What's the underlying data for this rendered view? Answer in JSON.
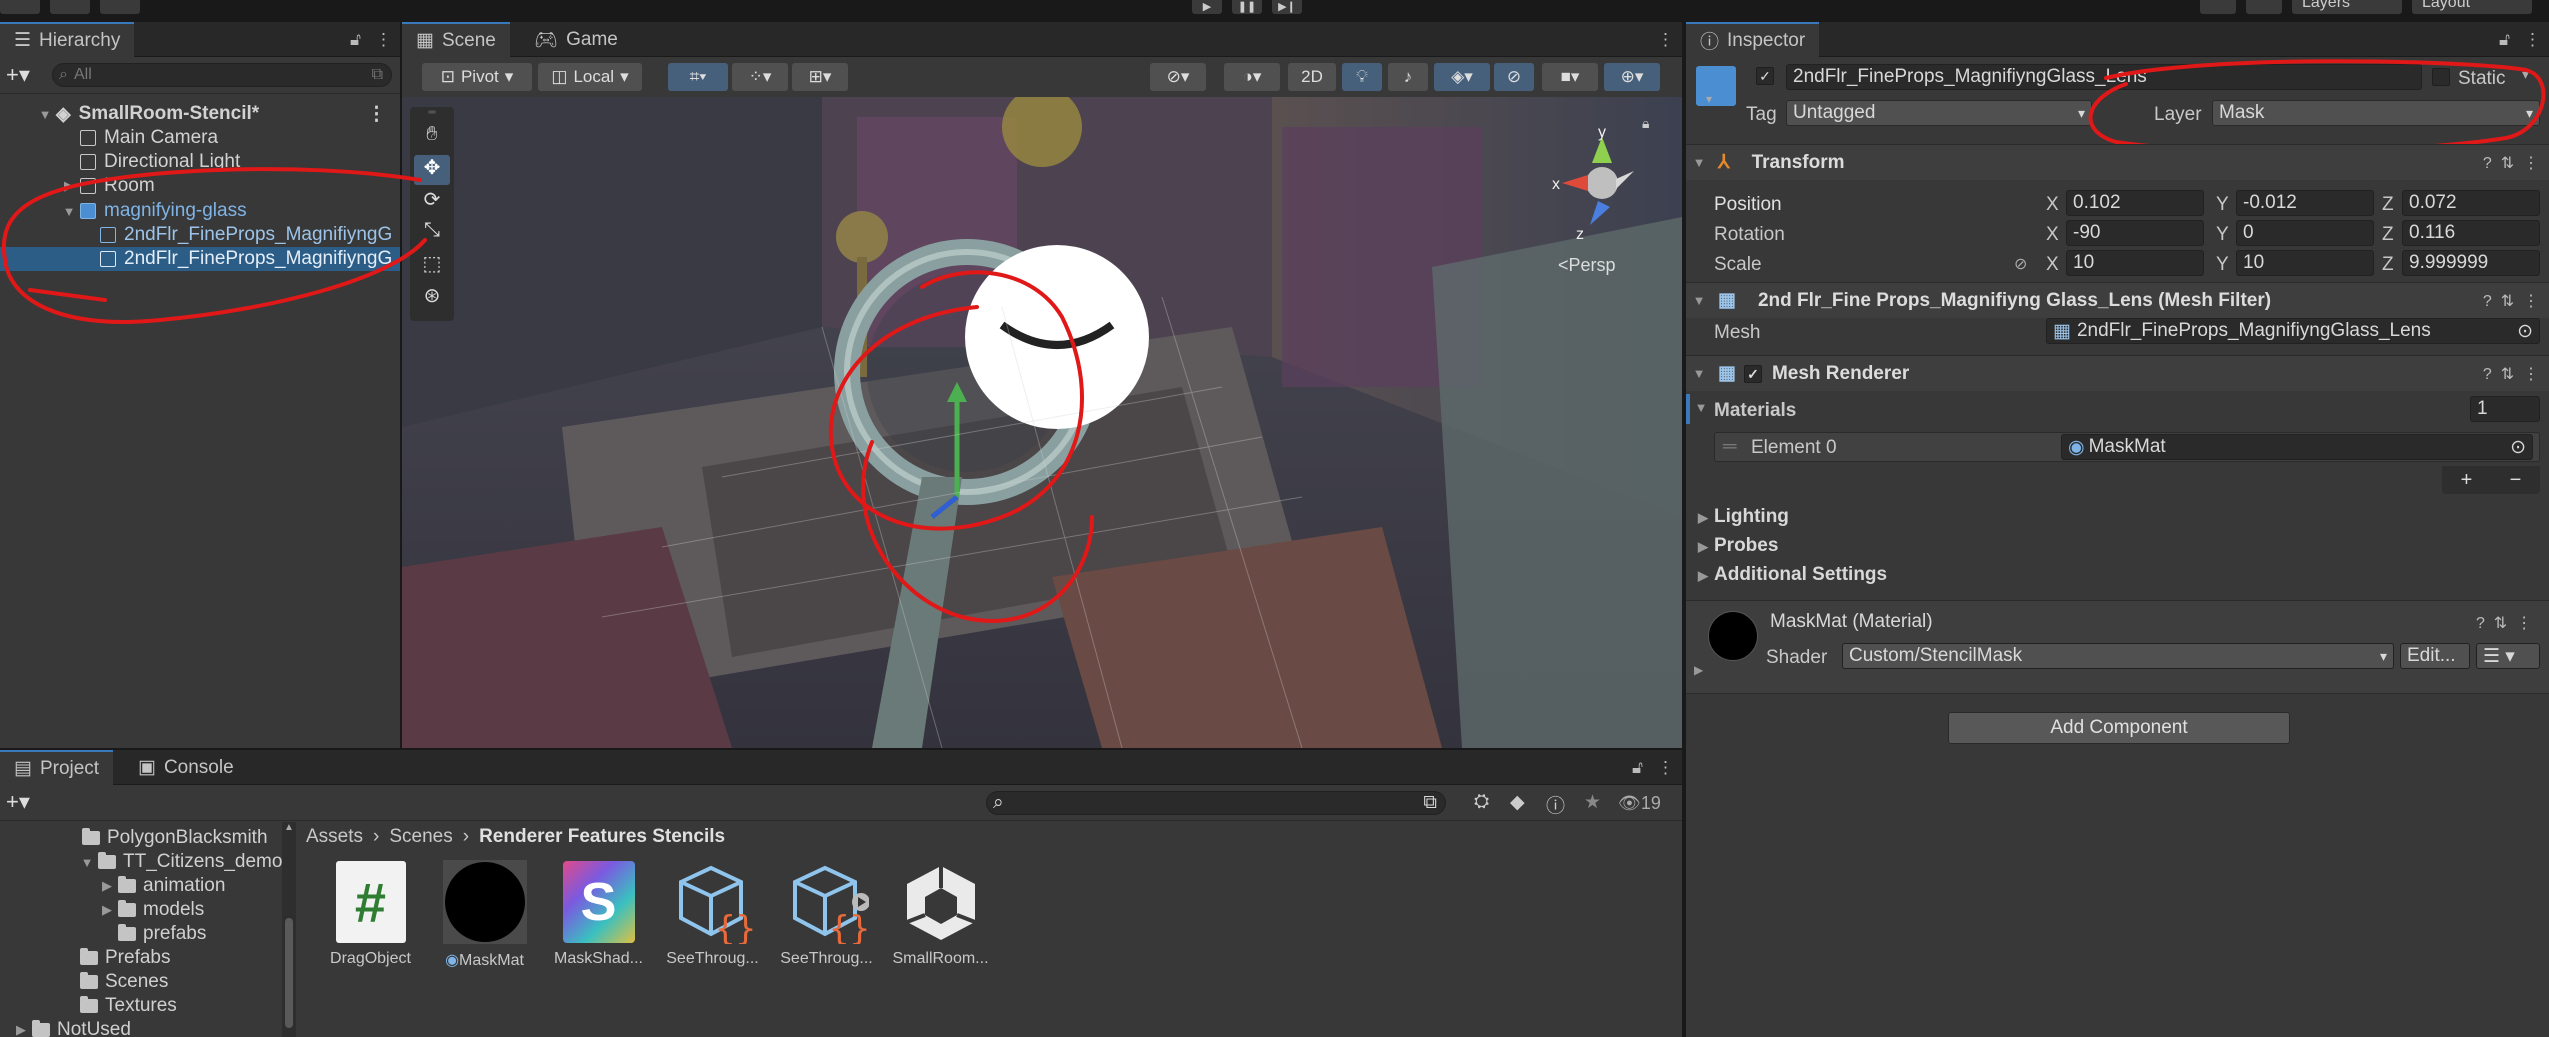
{
  "hierarchy": {
    "tab": "Hierarchy",
    "search_placeholder": "All",
    "scene": "SmallRoom-Stencil*",
    "items": [
      "Main Camera",
      "Directional Light",
      "Room",
      "magnifying-glass",
      "2ndFlr_FineProps_MagnifiyngG",
      "2ndFlr_FineProps_MagnifiyngG"
    ]
  },
  "scene_view": {
    "tabs": [
      "Scene",
      "Game"
    ],
    "pivot": "Pivot",
    "local": "Local",
    "mode_2d": "2D",
    "persp": "Persp",
    "gizmo_axes": [
      "y",
      "x",
      "z"
    ]
  },
  "inspector": {
    "tab": "Inspector",
    "object_name": "2ndFlr_FineProps_MagnifiyngGlass_Lens",
    "static_label": "Static",
    "tag_label": "Tag",
    "tag_value": "Untagged",
    "layer_label": "Layer",
    "layer_value": "Mask",
    "transform": {
      "title": "Transform",
      "position_label": "Position",
      "rotation_label": "Rotation",
      "scale_label": "Scale",
      "axis_x": "X",
      "axis_y": "Y",
      "axis_z": "Z",
      "position": [
        "0.102",
        "-0.012",
        "0.072"
      ],
      "rotation": [
        "-90",
        "0",
        "0.116"
      ],
      "scale": [
        "10",
        "10",
        "9.999999"
      ]
    },
    "mesh_filter": {
      "title": "2nd Flr_Fine Props_Magnifiyng Glass_Lens (Mesh Filter)",
      "mesh_label": "Mesh",
      "mesh_value": "2ndFlr_FineProps_MagnifiyngGlass_Lens"
    },
    "mesh_renderer": {
      "title": "Mesh Renderer",
      "materials_label": "Materials",
      "materials_count": "1",
      "element_label": "Element 0",
      "element_value": "MaskMat",
      "plus": "+",
      "minus": "−",
      "foldouts": [
        "Lighting",
        "Probes",
        "Additional Settings"
      ]
    },
    "material": {
      "title": "MaskMat (Material)",
      "shader_label": "Shader",
      "shader_value": "Custom/StencilMask",
      "edit_button": "Edit..."
    },
    "add_component": "Add Component"
  },
  "project": {
    "tabs": [
      "Project",
      "Console"
    ],
    "hidden_count": "19",
    "tree": [
      "PolygonBlacksmith",
      "TT_Citizens_demo",
      "animation",
      "models",
      "prefabs",
      "Prefabs",
      "Scenes",
      "Textures",
      "NotUsed"
    ],
    "breadcrumb": [
      "Assets",
      "Scenes",
      "Renderer Features Stencils"
    ],
    "assets": [
      "DragObject",
      "MaskMat",
      "MaskShad...",
      "SeeThroug...",
      "SeeThroug...",
      "SmallRoom..."
    ],
    "asset_glyph_hash": "#",
    "asset_glyph_s": "S"
  },
  "toolbar": {
    "layers": "Layers",
    "layout": "Layout"
  }
}
